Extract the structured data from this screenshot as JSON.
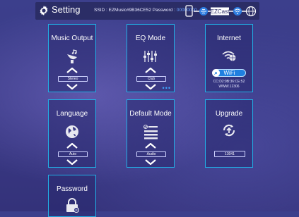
{
  "header": {
    "title": "Setting",
    "ssid_label": "SSID :",
    "ssid_value": "EZMusic#9B36CE52",
    "password_label": "Password :",
    "password_value": "00000000",
    "network_label": "EZCast"
  },
  "cards": {
    "music_output": {
      "label": "Music Output",
      "value": "Stereo"
    },
    "eq_mode": {
      "label": "EQ Mode",
      "value": "Club"
    },
    "internet": {
      "label": "Internet",
      "wifi_button": "WiFi",
      "mac": "CC:D2:9B:36:CE:52",
      "site": "WWW.12306"
    },
    "language": {
      "label": "Language",
      "value": "Auto"
    },
    "default_mode": {
      "label": "Default Mode",
      "value": "Audio"
    },
    "upgrade": {
      "label": "Upgrade",
      "version": "13041"
    },
    "password": {
      "label": "Password"
    }
  },
  "colors": {
    "accent": "#21b0e6",
    "background": "#3a3a86",
    "wifi_button": "#1f7fe0"
  }
}
